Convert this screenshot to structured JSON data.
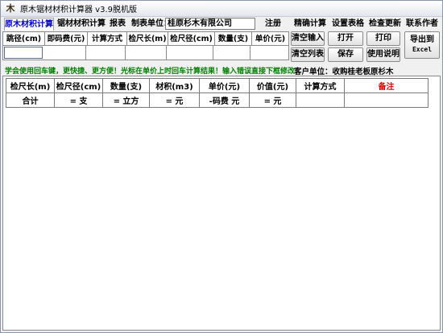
{
  "window": {
    "title": "原木锯材材积计算器 v3.9脱机版",
    "icon": "log-icon"
  },
  "menu": {
    "tabs": [
      "原木材积计算",
      "锯材材积计算",
      "报表"
    ],
    "unit_label": "制表单位：",
    "unit_value": "桂原杉木有限公司",
    "register": "注册",
    "precise": "精确计算",
    "settings": "设置表格",
    "update": "检查更新",
    "contact": "联系作者"
  },
  "input_table": {
    "headers": [
      "跳径(cm)",
      "即码费(元)",
      "计算方式",
      "检尺长(m)",
      "检尺径(cm)",
      "数量(支)",
      "单价(元)"
    ]
  },
  "buttons": {
    "clear_input": "清空输入",
    "open": "打开",
    "print": "打印",
    "clear_list": "清空列表",
    "save": "保存",
    "help": "使用说明",
    "export_line1": "导出到",
    "export_line2": "Excel"
  },
  "tip": "学会使用回车键，更快捷、更方便！光标在单价上时回车计算结果！输入错误直接下框修改！",
  "customer": {
    "label": "客户单位：",
    "value": "收购桂老板原杉木"
  },
  "result_table": {
    "headers": [
      "检尺长(m)",
      "检尺径(cm)",
      "数量(支)",
      "材积(m3)",
      "单价(元)",
      "价值(元)",
      "计算方式",
      "备注"
    ],
    "totals": [
      "合计",
      "= 支",
      "= 立方",
      "= 元",
      "-码费 元",
      "= 元",
      "",
      ""
    ]
  }
}
